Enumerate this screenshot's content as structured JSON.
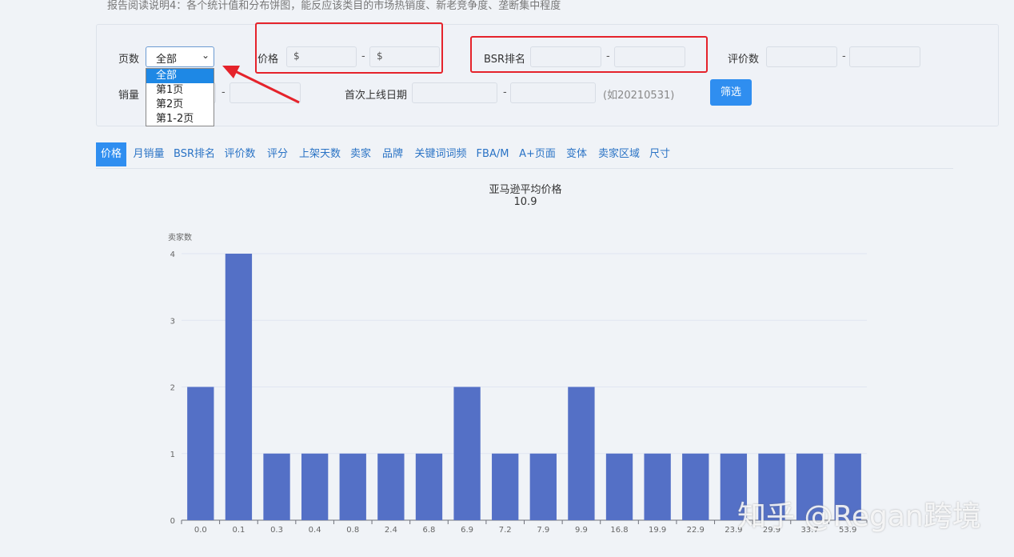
{
  "note": "报告阅读说明4：各个统计值和分布饼图，能反应该类目的市场热销度、新老竞争度、垄断集中程度",
  "filters": {
    "page_label": "页数",
    "page_select_value": "全部",
    "page_options": [
      "全部",
      "第1页",
      "第2页",
      "第1-2页"
    ],
    "price_label": "价格",
    "price_min_prefix": "$",
    "price_max_prefix": "$",
    "bsr_label": "BSR排名",
    "review_label": "评价数",
    "sales_label": "销量",
    "launch_label": "首次上线日期",
    "launch_hint": "(如20210531)",
    "dash": "-",
    "filter_button": "筛选"
  },
  "tabs": [
    "价格",
    "月销量",
    "BSR排名",
    "评价数",
    "评分",
    "上架天数",
    "卖家",
    "品牌",
    "关键词词频",
    "FBA/M",
    "A+页面",
    "变体",
    "卖家区域",
    "尺寸"
  ],
  "active_tab": "价格",
  "chart_title": "亚马逊平均价格",
  "chart_value": "10.9",
  "watermark": "知乎 @Regan跨境",
  "colors": {
    "accent": "#2f8ef0",
    "bar": "#5470c6",
    "highlight": "#e5232b"
  },
  "chart_data": {
    "type": "bar",
    "title": "亚马逊平均价格",
    "subtitle": "10.9",
    "ylabel": "卖家数",
    "xlabel": "",
    "categories": [
      "0.0",
      "0.1",
      "0.3",
      "0.4",
      "0.8",
      "2.4",
      "6.8",
      "6.9",
      "7.2",
      "7.9",
      "9.9",
      "16.8",
      "19.9",
      "22.9",
      "23.9",
      "29.9",
      "33.7",
      "53.9"
    ],
    "values": [
      2,
      4,
      1,
      1,
      1,
      1,
      1,
      2,
      1,
      1,
      2,
      1,
      1,
      1,
      1,
      1,
      1,
      1
    ],
    "yticks": [
      0,
      1,
      2,
      3,
      4
    ],
    "ylim": [
      0,
      4
    ],
    "grid": true
  }
}
